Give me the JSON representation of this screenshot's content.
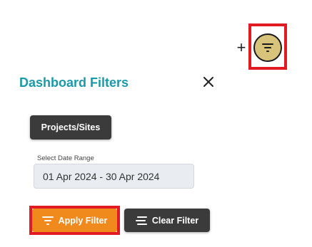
{
  "toolbar": {
    "add_icon": "plus-icon",
    "filter_toggle_icon": "filter-icon",
    "add_glyph": "+"
  },
  "panel": {
    "title": "Dashboard Filters",
    "close_icon": "close-icon"
  },
  "filters": {
    "projects_button_label": "Projects/Sites",
    "date_range_label": "Select Date Range",
    "date_range_value": "01 Apr 2024 - 30 Apr 2024"
  },
  "actions": {
    "apply_label": "Apply Filter",
    "clear_label": "Clear Filter",
    "apply_icon": "filter-icon",
    "clear_icon": "lines-icon"
  },
  "colors": {
    "accent_title": "#1a9aa8",
    "apply_bg": "#f18a1c",
    "dark_button_bg": "#3b3b3b",
    "filter_toggle_bg": "#d8c37a",
    "highlight": "#e11b22"
  }
}
